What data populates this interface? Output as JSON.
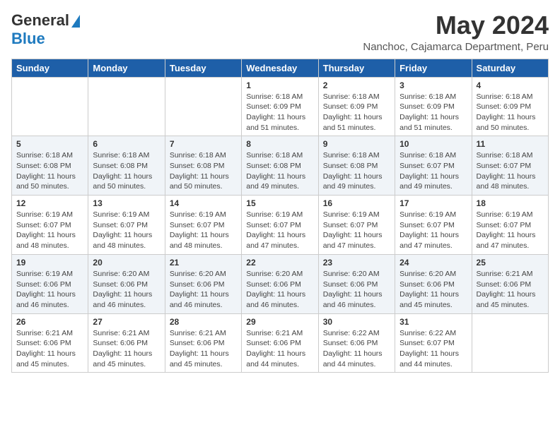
{
  "header": {
    "logo_general": "General",
    "logo_blue": "Blue",
    "month_year": "May 2024",
    "location": "Nanchoc, Cajamarca Department, Peru"
  },
  "calendar": {
    "days_of_week": [
      "Sunday",
      "Monday",
      "Tuesday",
      "Wednesday",
      "Thursday",
      "Friday",
      "Saturday"
    ],
    "weeks": [
      [
        {
          "day": "",
          "info": ""
        },
        {
          "day": "",
          "info": ""
        },
        {
          "day": "",
          "info": ""
        },
        {
          "day": "1",
          "info": "Sunrise: 6:18 AM\nSunset: 6:09 PM\nDaylight: 11 hours\nand 51 minutes."
        },
        {
          "day": "2",
          "info": "Sunrise: 6:18 AM\nSunset: 6:09 PM\nDaylight: 11 hours\nand 51 minutes."
        },
        {
          "day": "3",
          "info": "Sunrise: 6:18 AM\nSunset: 6:09 PM\nDaylight: 11 hours\nand 51 minutes."
        },
        {
          "day": "4",
          "info": "Sunrise: 6:18 AM\nSunset: 6:09 PM\nDaylight: 11 hours\nand 50 minutes."
        }
      ],
      [
        {
          "day": "5",
          "info": "Sunrise: 6:18 AM\nSunset: 6:08 PM\nDaylight: 11 hours\nand 50 minutes."
        },
        {
          "day": "6",
          "info": "Sunrise: 6:18 AM\nSunset: 6:08 PM\nDaylight: 11 hours\nand 50 minutes."
        },
        {
          "day": "7",
          "info": "Sunrise: 6:18 AM\nSunset: 6:08 PM\nDaylight: 11 hours\nand 50 minutes."
        },
        {
          "day": "8",
          "info": "Sunrise: 6:18 AM\nSunset: 6:08 PM\nDaylight: 11 hours\nand 49 minutes."
        },
        {
          "day": "9",
          "info": "Sunrise: 6:18 AM\nSunset: 6:08 PM\nDaylight: 11 hours\nand 49 minutes."
        },
        {
          "day": "10",
          "info": "Sunrise: 6:18 AM\nSunset: 6:07 PM\nDaylight: 11 hours\nand 49 minutes."
        },
        {
          "day": "11",
          "info": "Sunrise: 6:18 AM\nSunset: 6:07 PM\nDaylight: 11 hours\nand 48 minutes."
        }
      ],
      [
        {
          "day": "12",
          "info": "Sunrise: 6:19 AM\nSunset: 6:07 PM\nDaylight: 11 hours\nand 48 minutes."
        },
        {
          "day": "13",
          "info": "Sunrise: 6:19 AM\nSunset: 6:07 PM\nDaylight: 11 hours\nand 48 minutes."
        },
        {
          "day": "14",
          "info": "Sunrise: 6:19 AM\nSunset: 6:07 PM\nDaylight: 11 hours\nand 48 minutes."
        },
        {
          "day": "15",
          "info": "Sunrise: 6:19 AM\nSunset: 6:07 PM\nDaylight: 11 hours\nand 47 minutes."
        },
        {
          "day": "16",
          "info": "Sunrise: 6:19 AM\nSunset: 6:07 PM\nDaylight: 11 hours\nand 47 minutes."
        },
        {
          "day": "17",
          "info": "Sunrise: 6:19 AM\nSunset: 6:07 PM\nDaylight: 11 hours\nand 47 minutes."
        },
        {
          "day": "18",
          "info": "Sunrise: 6:19 AM\nSunset: 6:07 PM\nDaylight: 11 hours\nand 47 minutes."
        }
      ],
      [
        {
          "day": "19",
          "info": "Sunrise: 6:19 AM\nSunset: 6:06 PM\nDaylight: 11 hours\nand 46 minutes."
        },
        {
          "day": "20",
          "info": "Sunrise: 6:20 AM\nSunset: 6:06 PM\nDaylight: 11 hours\nand 46 minutes."
        },
        {
          "day": "21",
          "info": "Sunrise: 6:20 AM\nSunset: 6:06 PM\nDaylight: 11 hours\nand 46 minutes."
        },
        {
          "day": "22",
          "info": "Sunrise: 6:20 AM\nSunset: 6:06 PM\nDaylight: 11 hours\nand 46 minutes."
        },
        {
          "day": "23",
          "info": "Sunrise: 6:20 AM\nSunset: 6:06 PM\nDaylight: 11 hours\nand 46 minutes."
        },
        {
          "day": "24",
          "info": "Sunrise: 6:20 AM\nSunset: 6:06 PM\nDaylight: 11 hours\nand 45 minutes."
        },
        {
          "day": "25",
          "info": "Sunrise: 6:21 AM\nSunset: 6:06 PM\nDaylight: 11 hours\nand 45 minutes."
        }
      ],
      [
        {
          "day": "26",
          "info": "Sunrise: 6:21 AM\nSunset: 6:06 PM\nDaylight: 11 hours\nand 45 minutes."
        },
        {
          "day": "27",
          "info": "Sunrise: 6:21 AM\nSunset: 6:06 PM\nDaylight: 11 hours\nand 45 minutes."
        },
        {
          "day": "28",
          "info": "Sunrise: 6:21 AM\nSunset: 6:06 PM\nDaylight: 11 hours\nand 45 minutes."
        },
        {
          "day": "29",
          "info": "Sunrise: 6:21 AM\nSunset: 6:06 PM\nDaylight: 11 hours\nand 44 minutes."
        },
        {
          "day": "30",
          "info": "Sunrise: 6:22 AM\nSunset: 6:06 PM\nDaylight: 11 hours\nand 44 minutes."
        },
        {
          "day": "31",
          "info": "Sunrise: 6:22 AM\nSunset: 6:07 PM\nDaylight: 11 hours\nand 44 minutes."
        },
        {
          "day": "",
          "info": ""
        }
      ]
    ]
  }
}
